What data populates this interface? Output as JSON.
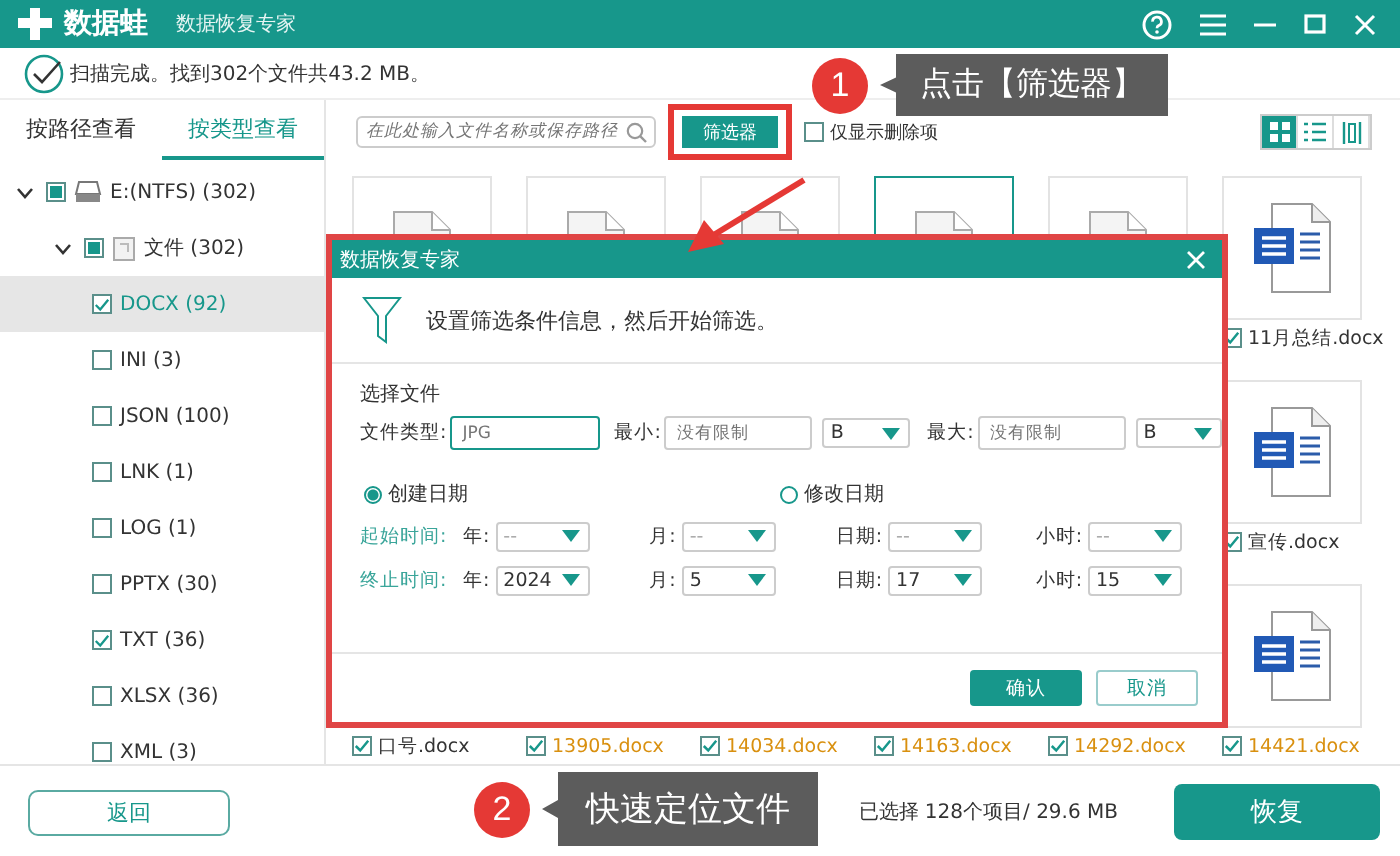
{
  "app": {
    "brand": "数据蛙",
    "subtitle": "数据恢复专家"
  },
  "scan_status": "扫描完成。找到302个文件共43.2 MB。",
  "sidebar": {
    "tabs": [
      {
        "label": "按路径查看",
        "selected": false
      },
      {
        "label": "按类型查看",
        "selected": true
      }
    ],
    "tree": [
      {
        "label": "E:(NTFS) (302)",
        "kind": "drive",
        "checked": false,
        "partial": true,
        "expanded": true,
        "selected": false,
        "children": [
          {
            "label": "文件 (302)",
            "kind": "folder",
            "checked": false,
            "partial": true,
            "expanded": true,
            "selected": false,
            "children": [
              {
                "label": "DOCX (92)",
                "checked": true,
                "selected": true
              },
              {
                "label": "INI (3)",
                "checked": false,
                "selected": false
              },
              {
                "label": "JSON (100)",
                "checked": false,
                "selected": false
              },
              {
                "label": "LNK (1)",
                "checked": false,
                "selected": false
              },
              {
                "label": "LOG (1)",
                "checked": false,
                "selected": false
              },
              {
                "label": "PPTX (30)",
                "checked": false,
                "selected": false
              },
              {
                "label": "TXT (36)",
                "checked": true,
                "selected": false
              },
              {
                "label": "XLSX (36)",
                "checked": false,
                "selected": false
              },
              {
                "label": "XML (3)",
                "checked": false,
                "selected": false
              }
            ]
          }
        ]
      }
    ],
    "back_button": "返回"
  },
  "toolbar": {
    "search_placeholder": "在此处输入文件名称或保存路径",
    "filter_button": "筛选器",
    "deleted_only": {
      "label": "仅显示删除项",
      "checked": false
    },
    "view_modes": [
      {
        "kind": "grid",
        "selected": true
      },
      {
        "kind": "list",
        "selected": false
      },
      {
        "kind": "columns",
        "selected": false
      }
    ]
  },
  "grid": [
    {
      "tiles": [
        {
          "kind": "document",
          "selected": false
        },
        {
          "kind": "document",
          "selected": false
        },
        {
          "kind": "document",
          "selected": false
        },
        {
          "kind": "document",
          "selected": true
        },
        {
          "kind": "document",
          "selected": false
        },
        {
          "kind": "word",
          "name": "11月总结.docx",
          "checked": true,
          "deleted": false,
          "selected": false
        }
      ]
    },
    {
      "tiles": [
        {
          "kind": "word",
          "name": "宣传.docx",
          "checked": true,
          "deleted": false,
          "selected": false
        }
      ]
    },
    {
      "tiles": [
        {
          "kind": "covered",
          "name": "口号.docx",
          "checked": true,
          "deleted": false,
          "selected": false
        },
        {
          "kind": "covered",
          "name": "13905.docx",
          "checked": true,
          "deleted": true,
          "selected": false
        },
        {
          "kind": "covered",
          "name": "14034.docx",
          "checked": true,
          "deleted": true,
          "selected": false
        },
        {
          "kind": "covered",
          "name": "14163.docx",
          "checked": true,
          "deleted": true,
          "selected": false
        },
        {
          "kind": "covered",
          "name": "14292.docx",
          "checked": true,
          "deleted": true,
          "selected": false
        },
        {
          "kind": "word",
          "name": "14421.docx",
          "checked": true,
          "deleted": true,
          "selected": false
        }
      ]
    }
  ],
  "footer": {
    "selection": "已选择 128个项目/ 29.6 MB",
    "recover_button": "恢复"
  },
  "dialog": {
    "title": "数据恢复专家",
    "intro": "设置筛选条件信息，然后开始筛选。",
    "section": "选择文件",
    "type": {
      "label": "文件类型:",
      "placeholder": "JPG",
      "focused": true
    },
    "min": {
      "label": "最小:",
      "placeholder": "没有限制",
      "unit": "B",
      "focused": false
    },
    "max": {
      "label": "最大:",
      "placeholder": "没有限制",
      "unit": "B",
      "focused": false
    },
    "date_modes": [
      {
        "label": "创建日期",
        "selected": true
      },
      {
        "label": "修改日期",
        "selected": false
      }
    ],
    "ranges": [
      {
        "label": "起始时间:",
        "fields": [
          {
            "label": "年:",
            "value": "--"
          },
          {
            "label": "月:",
            "value": "--"
          },
          {
            "label": "日期:",
            "value": "--"
          },
          {
            "label": "小时:",
            "value": "--"
          }
        ]
      },
      {
        "label": "终止时间:",
        "fields": [
          {
            "label": "年:",
            "value": "2024"
          },
          {
            "label": "月:",
            "value": "5"
          },
          {
            "label": "日期:",
            "value": "17"
          },
          {
            "label": "小时:",
            "value": "15"
          }
        ]
      }
    ],
    "confirm": "确认",
    "cancel": "取消"
  },
  "callouts": [
    {
      "number": "1",
      "text": "点击【筛选器】"
    },
    {
      "number": "2",
      "text": "快速定位文件"
    }
  ]
}
